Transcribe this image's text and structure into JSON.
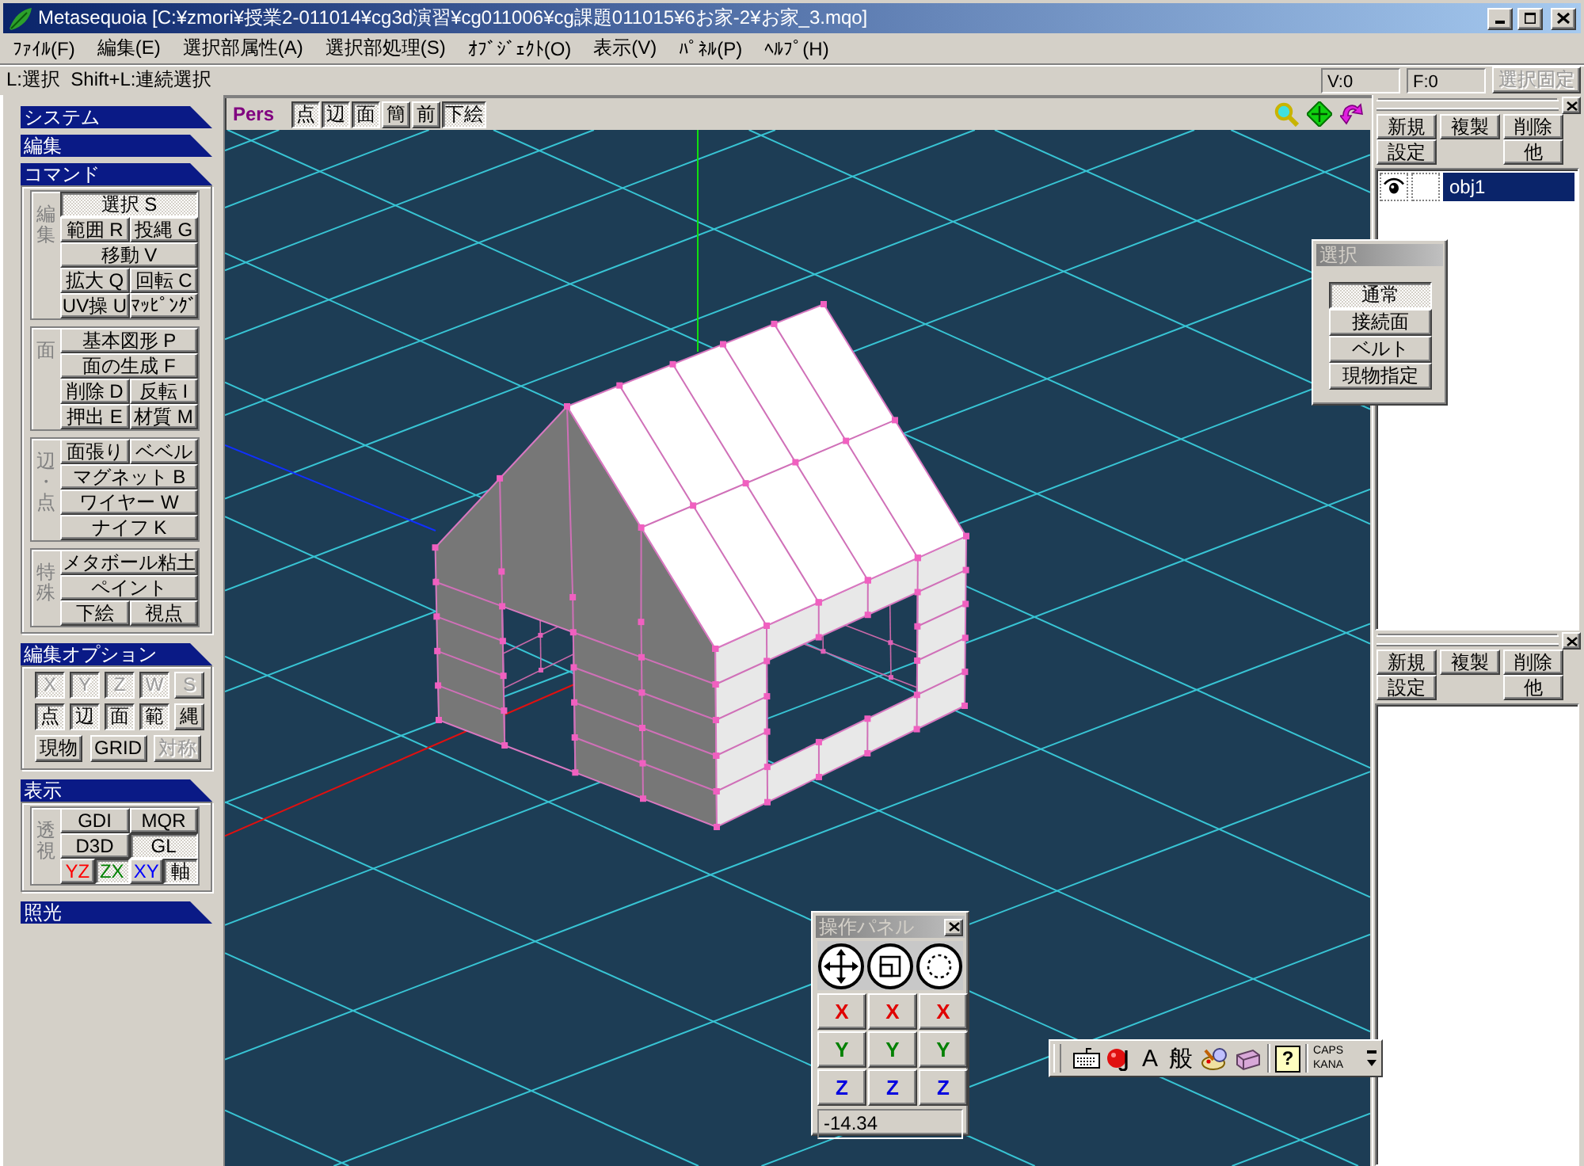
{
  "window": {
    "title": "Metasequoia [C:¥zmori¥授業2-011014¥cg3d演習¥cg011006¥cg課題011015¥6お家-2¥お家_3.mqo]"
  },
  "menu": [
    "ﾌｧｲﾙ(F)",
    "編集(E)",
    "選択部属性(A)",
    "選択部処理(S)",
    "ｵﾌﾞｼﾞｪｸﾄ(O)",
    "表示(V)",
    "ﾊﾟﾈﾙ(P)",
    "ﾍﾙﾌﾟ(H)"
  ],
  "hint_bar": {
    "hint": "L:選択  Shift+L:連続選択",
    "vertex_count": "V:0",
    "face_count": "F:0",
    "lock_button": {
      "label": "選択固定",
      "disabled": true
    }
  },
  "left_panel": {
    "sections": [
      {
        "title": "システム"
      },
      {
        "title": "編集"
      },
      {
        "title": "コマンド",
        "groups": [
          {
            "label": "編集",
            "rows": [
              [
                {
                  "label": "選択 S",
                  "selected": true
                }
              ],
              [
                {
                  "label": "範囲 R",
                  "selected": false
                },
                {
                  "label": "投縄 G",
                  "selected": false
                }
              ],
              [
                {
                  "label": "移動 V",
                  "selected": false
                }
              ],
              [
                {
                  "label": "拡大 Q",
                  "selected": false
                },
                {
                  "label": "回転 C",
                  "selected": false
                }
              ],
              [
                {
                  "label": "UV操 U",
                  "selected": false
                },
                {
                  "label": "ﾏｯﾋﾟﾝｸﾞ",
                  "selected": false
                }
              ]
            ]
          },
          {
            "label": "面",
            "rows": [
              [
                {
                  "label": "基本図形 P",
                  "selected": false
                }
              ],
              [
                {
                  "label": "面の生成 F",
                  "selected": false
                }
              ],
              [
                {
                  "label": "削除 D",
                  "selected": false
                },
                {
                  "label": "反転 I",
                  "selected": false
                }
              ],
              [
                {
                  "label": "押出 E",
                  "selected": false
                },
                {
                  "label": "材質 M",
                  "selected": false
                }
              ]
            ]
          },
          {
            "label": "辺・点",
            "rows": [
              [
                {
                  "label": "面張り",
                  "selected": false
                },
                {
                  "label": "ベベル",
                  "selected": false
                }
              ],
              [
                {
                  "label": "マグネット B",
                  "selected": false
                }
              ],
              [
                {
                  "label": "ワイヤー W",
                  "selected": false
                }
              ],
              [
                {
                  "label": "ナイフ K",
                  "selected": false
                }
              ]
            ]
          },
          {
            "label": "特殊",
            "rows": [
              [
                {
                  "label": "メタボール粘土",
                  "selected": false
                }
              ],
              [
                {
                  "label": "ペイント",
                  "selected": false
                }
              ],
              [
                {
                  "label": "下絵",
                  "selected": false
                },
                {
                  "label": "視点",
                  "selected": false
                }
              ]
            ]
          }
        ]
      },
      {
        "title": "編集オプション",
        "axis_toggles": [
          {
            "label": "X",
            "selected": true,
            "disabled": true
          },
          {
            "label": "Y",
            "selected": true,
            "disabled": true
          },
          {
            "label": "Z",
            "selected": true,
            "disabled": true
          },
          {
            "label": "W",
            "selected": true,
            "disabled": true
          },
          {
            "label": "S",
            "selected": false,
            "disabled": true
          }
        ],
        "target_toggles": [
          {
            "label": "点",
            "selected": true,
            "disabled": false
          },
          {
            "label": "辺",
            "selected": true,
            "disabled": false
          },
          {
            "label": "面",
            "selected": true,
            "disabled": false
          },
          {
            "label": "範",
            "selected": true,
            "disabled": false
          },
          {
            "label": "縄",
            "selected": false,
            "disabled": false
          }
        ],
        "extra_buttons": [
          {
            "label": "現物",
            "selected": false,
            "disabled": false
          },
          {
            "label": "GRID",
            "selected": false,
            "disabled": false
          },
          {
            "label": "対称",
            "selected": false,
            "disabled": true
          }
        ]
      },
      {
        "title": "表示",
        "groups": [
          {
            "label": "透視",
            "rows": [
              [
                {
                  "label": "GDI",
                  "selected": false
                },
                {
                  "label": "MQR",
                  "selected": false
                }
              ],
              [
                {
                  "label": "D3D",
                  "selected": false
                },
                {
                  "label": "GL",
                  "selected": true
                }
              ],
              [
                {
                  "label": "YZ",
                  "selected": false,
                  "color": "#ff0000"
                },
                {
                  "label": "ZX",
                  "selected": true,
                  "color": "#008000"
                },
                {
                  "label": "XY",
                  "selected": false,
                  "color": "#0000ff"
                },
                {
                  "label": "軸",
                  "selected": true,
                  "color": "#000000"
                }
              ]
            ]
          }
        ]
      },
      {
        "title": "照光"
      }
    ]
  },
  "viewport": {
    "projection": "Pers",
    "toggles": [
      {
        "label": "点",
        "on": true
      },
      {
        "label": "辺",
        "on": true
      },
      {
        "label": "面",
        "on": true
      },
      {
        "label": "簡",
        "on": false
      },
      {
        "label": "前",
        "on": false
      },
      {
        "label": "下絵",
        "on": true
      }
    ]
  },
  "object_panel": {
    "buttons": [
      [
        "新規",
        "複製",
        "削除"
      ],
      [
        "設定",
        "他"
      ]
    ],
    "items": [
      {
        "name": "obj1",
        "visible": true,
        "locked": false,
        "selected": true
      }
    ]
  },
  "material_panel": {
    "buttons": [
      [
        "新規",
        "複製",
        "削除"
      ],
      [
        "設定",
        "他"
      ]
    ]
  },
  "select_dialog": {
    "title": "選択",
    "buttons": [
      {
        "label": "通常",
        "selected": true
      },
      {
        "label": "接続面",
        "selected": false
      },
      {
        "label": "ベルト",
        "selected": false
      },
      {
        "label": "現物指定",
        "selected": false
      }
    ]
  },
  "operation_panel": {
    "title": "操作パネル",
    "axis_rows": [
      [
        {
          "label": "X",
          "color": "#e00000"
        },
        {
          "label": "X",
          "color": "#e00000"
        },
        {
          "label": "X",
          "color": "#e00000"
        }
      ],
      [
        {
          "label": "Y",
          "color": "#008000"
        },
        {
          "label": "Y",
          "color": "#008000"
        },
        {
          "label": "Y",
          "color": "#008000"
        }
      ],
      [
        {
          "label": "Z",
          "color": "#0000e0"
        },
        {
          "label": "Z",
          "color": "#0000e0"
        },
        {
          "label": "Z",
          "color": "#0000e0"
        }
      ]
    ],
    "value": "-14.34"
  },
  "ime_toolbar": {
    "mode_labels": [
      "A",
      "般"
    ],
    "help_label": "?",
    "caps_label": "CAPS",
    "kana_label": "KANA"
  }
}
